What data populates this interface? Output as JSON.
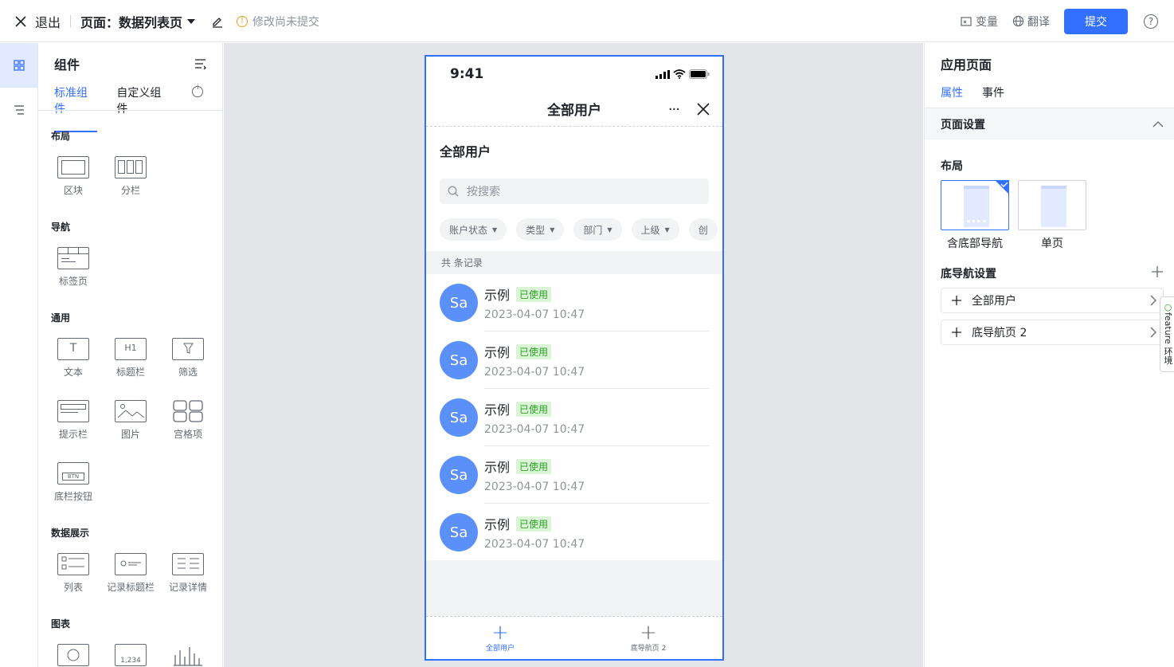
{
  "header": {
    "exit": "退出",
    "page_label": "页面：",
    "page_name": "数据列表页",
    "unsaved": "修改尚未提交",
    "vars": "变量",
    "translate": "翻译",
    "submit": "提交",
    "help": "?"
  },
  "left": {
    "title": "组件",
    "tabs": [
      "标准组件",
      "自定义组件"
    ],
    "sections": {
      "layout": "布局",
      "nav": "导航",
      "common": "通用",
      "data": "数据展示",
      "chart": "图表"
    },
    "items": {
      "block": "区块",
      "column": "分栏",
      "tabs": "标签页",
      "text": "文本",
      "title_bar": "标题栏",
      "filter": "筛选",
      "tip_bar": "提示栏",
      "image": "图片",
      "grid": "宫格项",
      "bottom_btn": "底栏按钮",
      "list": "列表",
      "record_title": "记录标题栏",
      "record_detail": "记录详情"
    },
    "btn_text": "BTN",
    "h_text": "H1",
    "num_text": "1,234"
  },
  "phone": {
    "time": "9:41",
    "title": "全部用户",
    "list_title": "全部用户",
    "search_placeholder": "按搜索",
    "filters": [
      "账户状态",
      "类型",
      "部门",
      "上级",
      "创"
    ],
    "count": "共 条记录",
    "rows": [
      {
        "avatar": "Sa",
        "name": "示例",
        "badge": "已使用",
        "date": "2023-04-07 10:47"
      },
      {
        "avatar": "Sa",
        "name": "示例",
        "badge": "已使用",
        "date": "2023-04-07 10:47"
      },
      {
        "avatar": "Sa",
        "name": "示例",
        "badge": "已使用",
        "date": "2023-04-07 10:47"
      },
      {
        "avatar": "Sa",
        "name": "示例",
        "badge": "已使用",
        "date": "2023-04-07 10:47"
      },
      {
        "avatar": "Sa",
        "name": "示例",
        "badge": "已使用",
        "date": "2023-04-07 10:47"
      }
    ],
    "tabbar": [
      {
        "label": "全部用户"
      },
      {
        "label": "底导航页 2"
      }
    ]
  },
  "right": {
    "title": "应用页面",
    "tabs": [
      "属性",
      "事件"
    ],
    "page_settings": "页面设置",
    "layout_label": "布局",
    "layouts": [
      "含底部导航",
      "单页"
    ],
    "bottom_nav": "底导航设置",
    "nav_items": [
      "全部用户",
      "底导航页 2"
    ]
  },
  "feature": "feature 环境",
  "colors": {
    "accent": "#3370ff",
    "avatar": "#5b8ff9",
    "badge": "#2ea121"
  }
}
